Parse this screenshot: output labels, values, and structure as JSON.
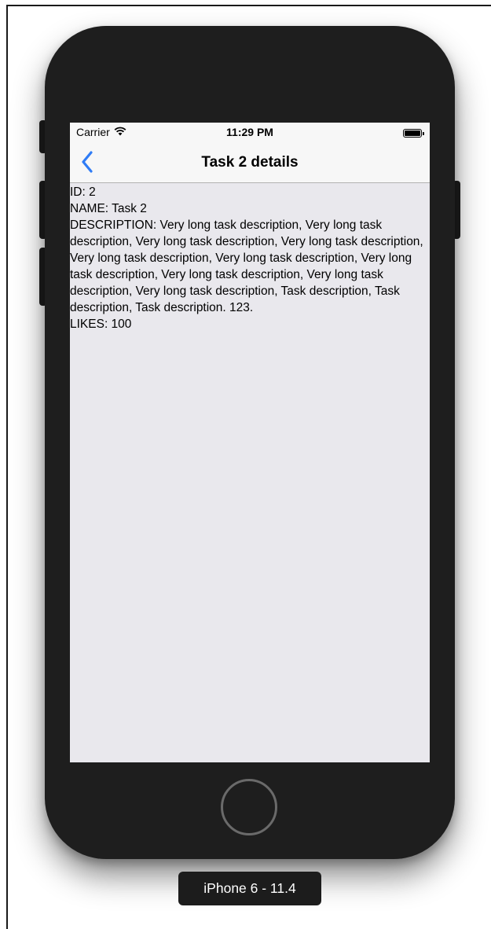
{
  "status_bar": {
    "carrier": "Carrier",
    "time": "11:29 PM",
    "wifi_icon": "wifi-icon",
    "battery_icon": "battery-icon"
  },
  "nav": {
    "back_icon": "chevron-left-icon",
    "title": "Task 2 details",
    "accent_color": "#2f7cf6"
  },
  "task": {
    "id_line": "ID: 2",
    "name_line": "NAME: Task 2",
    "description_line": "DESCRIPTION: Very long task description, Very long task description, Very long task description, Very long task description, Very long task description, Very long task description, Very long task description, Very long task description, Very long task description, Very long task description, Task description, Task description, Task description. 123.",
    "likes_line": "LIKES: 100"
  },
  "simulator": {
    "device_label": "iPhone 6 - 11.4"
  }
}
